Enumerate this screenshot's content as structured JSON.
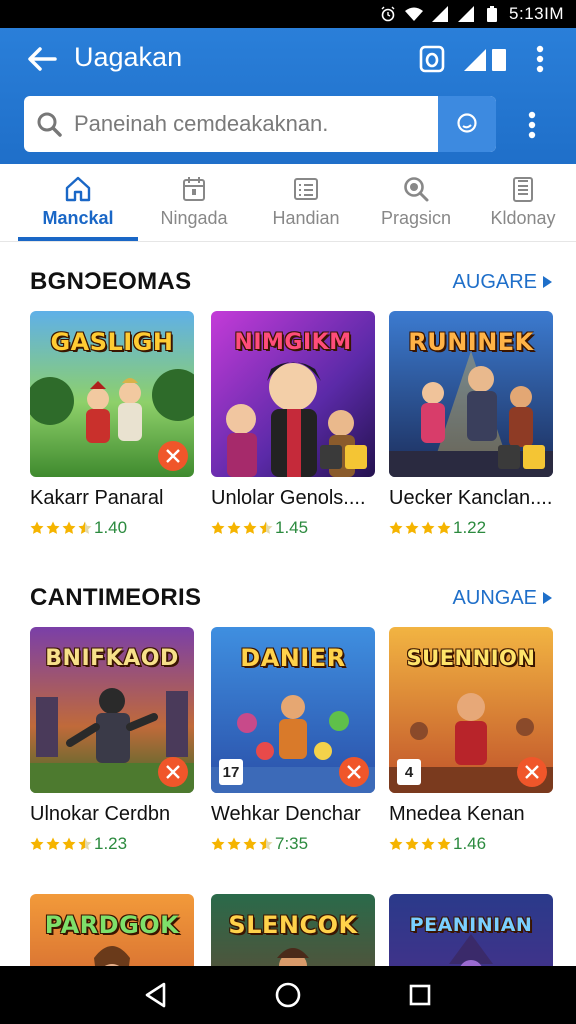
{
  "status_bar": {
    "time": "5:13IM"
  },
  "app_bar": {
    "title": "Uagakan",
    "search_placeholder": "Paneinah cemdeakaknan."
  },
  "tabs": [
    {
      "label": "Manckal",
      "icon": "home-icon",
      "active": true
    },
    {
      "label": "Ningada",
      "icon": "calendar-icon",
      "active": false
    },
    {
      "label": "Handian",
      "icon": "list-icon",
      "active": false
    },
    {
      "label": "Pragsicn",
      "icon": "search-icon",
      "active": false
    },
    {
      "label": "Kldonay",
      "icon": "document-icon",
      "active": false
    }
  ],
  "sections": [
    {
      "title": "BGNƆEOMAS",
      "more_label": "AUGARE",
      "items": [
        {
          "banner": "GASLIGH",
          "name": "Kakarr Panaral",
          "rating": "1.40",
          "stars": 3.5
        },
        {
          "banner": "NIMGIKM",
          "name": "Unlolar Genols....",
          "rating": "1.45",
          "stars": 3.5
        },
        {
          "banner": "RUNINEK",
          "name": "Uecker Kanclan....",
          "rating": "1.22",
          "stars": 4
        }
      ]
    },
    {
      "title": "CANTIMEORIS",
      "more_label": "AUNGAE",
      "items": [
        {
          "banner": "BNIFKAOD",
          "name": "Ulnokar Cerdbn",
          "rating": "1.23",
          "stars": 3.5,
          "badge": ""
        },
        {
          "banner": "DANIER",
          "name": "Wehkar Denchar",
          "rating": "7:35",
          "stars": 3.5,
          "badge": "17"
        },
        {
          "banner": "SUENNION",
          "name": "Mnedea Kenan",
          "rating": "1.46",
          "stars": 4,
          "badge": "4"
        }
      ]
    },
    {
      "title": "",
      "more_label": "",
      "items": [
        {
          "banner": "PARDGOK"
        },
        {
          "banner": "SLENCOK"
        },
        {
          "banner": "PEANINIAN"
        }
      ]
    }
  ],
  "colors": {
    "brand": "#1f6fc9",
    "accent_badge": "#f0562a",
    "rating_text": "#2b8a3e",
    "star": "#f5b400"
  }
}
